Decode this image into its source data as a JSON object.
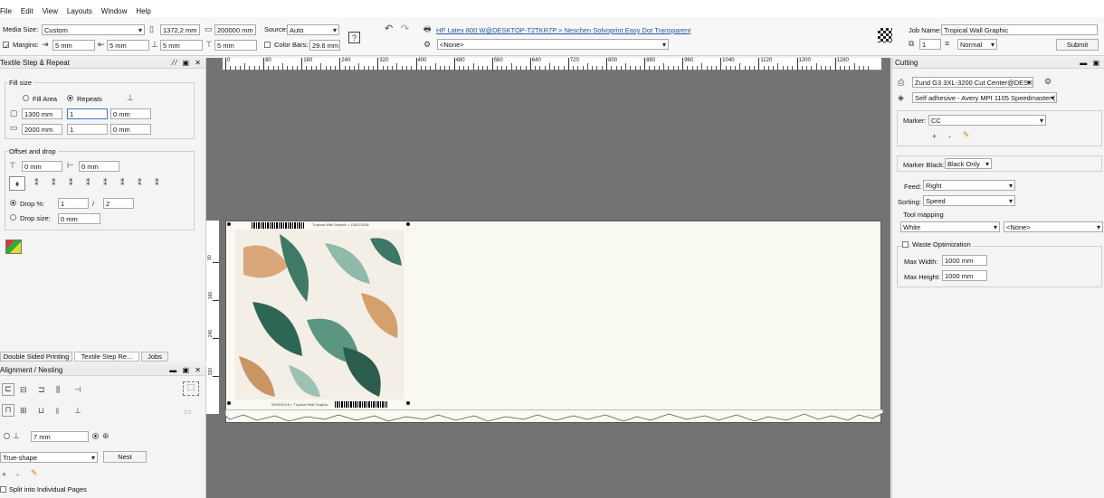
{
  "menu": [
    "File",
    "Edit",
    "View",
    "Layouts",
    "Window",
    "Help"
  ],
  "toolbar": {
    "media_size_label": "Media Size:",
    "media_size_value": "Custom",
    "width_value": "1372,2 mm",
    "length_value": "200000 mm",
    "source_label": "Source:",
    "source_value": "Auto",
    "margins_label": "Margins:",
    "margin_left": "5 mm",
    "margin_right": "5 mm",
    "margin_top": "5 mm",
    "margin_bottom": "5 mm",
    "color_bars_label": "Color Bars:",
    "color_bars_value": "29.6 mm",
    "printer_link": "HP Latex 800 W@DESKTOP-T2TKR7P > Neschen Solvoprint Easy Dot Transparent",
    "profile_value": "<None>",
    "job_name_label": "Job Name:",
    "job_name_value": "Tropical Wall Graphic",
    "copies_value": "1",
    "priority_value": "Normal",
    "submit_label": "Submit"
  },
  "textile": {
    "title": "Textile Step & Repeat",
    "fill_size_label": "Fill size",
    "fill_area_label": "Fill Area",
    "repeats_label": "Repeats",
    "row1": [
      "1300 mm",
      "1",
      "0 mm"
    ],
    "row2": [
      "2000 mm",
      "1",
      "0 mm"
    ],
    "offset_label": "Offset and drop",
    "offset_x": "0 mm",
    "offset_y": "0 mm",
    "drop_pct_label": "Drop %:",
    "drop_num": "1",
    "drop_sep": "/",
    "drop_den": "2",
    "drop_size_label": "Drop size:",
    "drop_size_value": "0 mm"
  },
  "tabs": [
    "Double Sided Printing",
    "Textile Step  Re...",
    "Jobs"
  ],
  "alignment": {
    "title": "Alignment / Nesting",
    "spacing_value": "7 mm",
    "shape_value": "True-shape",
    "nest_label": "Nest",
    "split_label": "Split into Individual Pages"
  },
  "ruler_ticks": [
    "0",
    "80",
    "160",
    "240",
    "320",
    "400",
    "480",
    "560",
    "640",
    "720",
    "800",
    "880",
    "960",
    "1040",
    "1120",
    "1200",
    "1280"
  ],
  "ruler_v_ticks": [
    "80",
    "160",
    "240",
    "320"
  ],
  "media_header_text": "Tropical Wall Graphic > 10/02/2018",
  "media_footer_text": "09/02/2018 > Tropical Wall Graphic",
  "cutting": {
    "title": "Cutting",
    "device_value": "Zund G3 3XL-3200 Cut Center@DESK1",
    "media_value": "Self adhesive - Avery MPI 1105 Speedmaster (",
    "marker_label": "Marker:",
    "marker_value": "CC",
    "marker_black_label": "Marker Black:",
    "marker_black_value": "Black Only",
    "feed_label": "Feed:",
    "feed_value": "Right",
    "sorting_label": "Sorting:",
    "sorting_value": "Speed",
    "tool_mapping_label": "Tool mapping",
    "tool_white": "White",
    "tool_none": "<None>",
    "waste_label": "Waste Optimization",
    "max_width_label": "Max Width:",
    "max_width_value": "1000 mm",
    "max_height_label": "Max Height:",
    "max_height_value": "1000 mm"
  },
  "colors": {
    "canvas": "#737373",
    "media": "#fafaf2",
    "link": "#2255aa"
  }
}
